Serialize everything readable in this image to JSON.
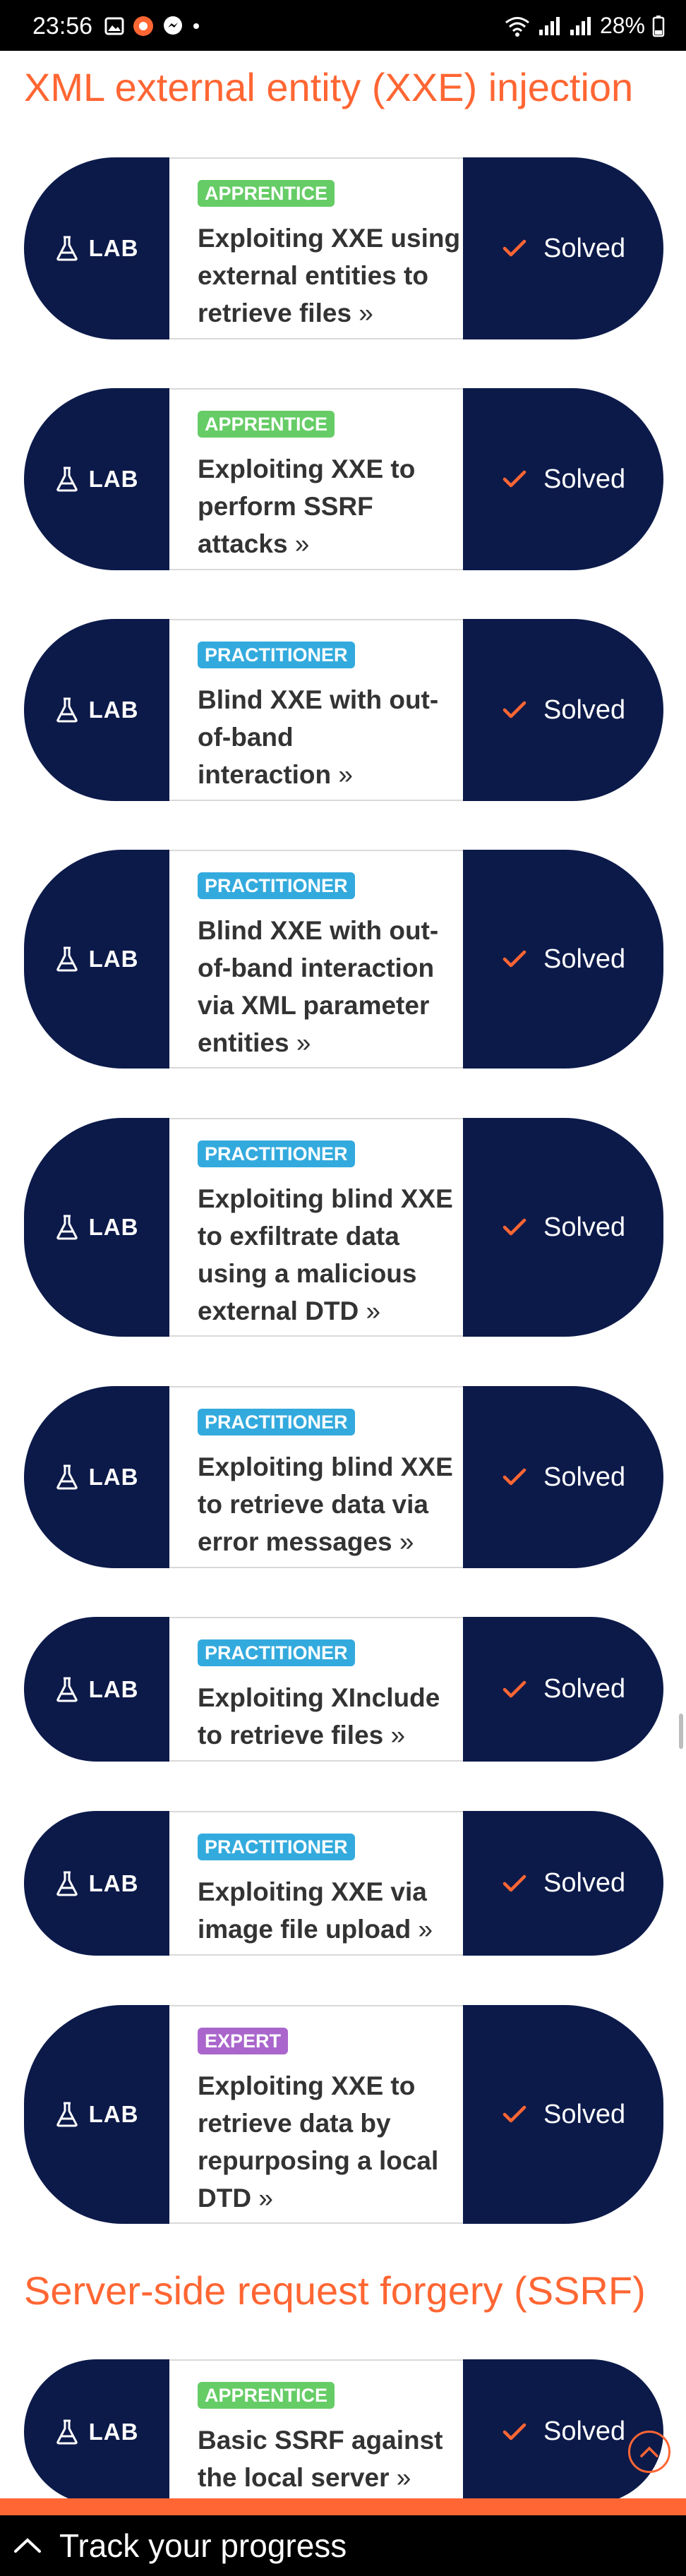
{
  "status_bar": {
    "time": "23:56",
    "battery": "28%"
  },
  "sections": [
    {
      "title": "XML external entity (XXE) injection",
      "labs": [
        {
          "type_label": "LAB",
          "level": "APPRENTICE",
          "level_class": "apprentice",
          "title_lines": [
            "Exploiting XXE using",
            "external entities to",
            "retrieve files"
          ],
          "status": "Solved"
        },
        {
          "type_label": "LAB",
          "level": "APPRENTICE",
          "level_class": "apprentice",
          "title_lines": [
            "Exploiting XXE to",
            "perform SSRF",
            "attacks"
          ],
          "status": "Solved"
        },
        {
          "type_label": "LAB",
          "level": "PRACTITIONER",
          "level_class": "practitioner",
          "title_lines": [
            "Blind XXE with out-",
            "of-band",
            "interaction"
          ],
          "status": "Solved"
        },
        {
          "type_label": "LAB",
          "level": "PRACTITIONER",
          "level_class": "practitioner",
          "title_lines": [
            "Blind XXE with out-",
            "of-band interaction",
            "via XML parameter",
            "entities"
          ],
          "status": "Solved"
        },
        {
          "type_label": "LAB",
          "level": "PRACTITIONER",
          "level_class": "practitioner",
          "title_lines": [
            "Exploiting blind XXE",
            "to exfiltrate data",
            "using a malicious",
            "external DTD"
          ],
          "status": "Solved"
        },
        {
          "type_label": "LAB",
          "level": "PRACTITIONER",
          "level_class": "practitioner",
          "title_lines": [
            "Exploiting blind XXE",
            "to retrieve data via",
            "error messages"
          ],
          "status": "Solved"
        },
        {
          "type_label": "LAB",
          "level": "PRACTITIONER",
          "level_class": "practitioner",
          "title_lines": [
            "Exploiting XInclude",
            "to retrieve files"
          ],
          "status": "Solved"
        },
        {
          "type_label": "LAB",
          "level": "PRACTITIONER",
          "level_class": "practitioner",
          "title_lines": [
            "Exploiting XXE via",
            "image file upload"
          ],
          "status": "Solved"
        },
        {
          "type_label": "LAB",
          "level": "EXPERT",
          "level_class": "expert",
          "title_lines": [
            "Exploiting XXE to",
            "retrieve data by",
            "repurposing a local",
            "DTD"
          ],
          "status": "Solved"
        }
      ]
    },
    {
      "title": "Server-side request forgery (SSRF)",
      "labs": [
        {
          "type_label": "LAB",
          "level": "APPRENTICE",
          "level_class": "apprentice",
          "title_lines": [
            "Basic SSRF against",
            "the local server"
          ],
          "status": "Solved"
        }
      ]
    }
  ],
  "footer": {
    "track_label": "Track your progress"
  },
  "colors": {
    "accent": "#ff6633",
    "navy": "#0c1a4a",
    "apprentice": "#66cc66",
    "practitioner": "#33aadd",
    "expert": "#aa66cc"
  }
}
